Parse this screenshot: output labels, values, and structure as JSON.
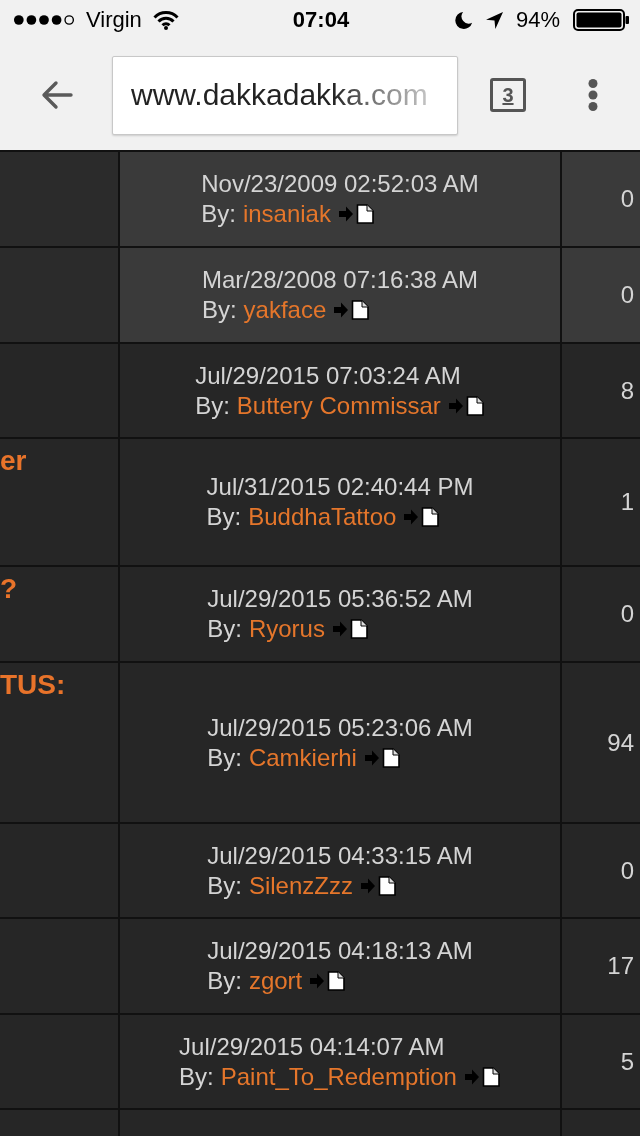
{
  "status_bar": {
    "carrier": "Virgin",
    "time": "07:04",
    "battery": "94%"
  },
  "toolbar": {
    "url": "www.dakkadakka.com",
    "tab_count": "3"
  },
  "table": {
    "rows": [
      {
        "highlighted": true,
        "date": "Nov/23/2009 02:52:03 AM",
        "by_label": "By:",
        "author": "insaniak",
        "replies": "0"
      },
      {
        "highlighted": true,
        "date": "Mar/28/2008 07:16:38 AM",
        "by_label": "By:",
        "author": "yakface",
        "replies": "0"
      },
      {
        "highlighted": false,
        "date": "Jul/29/2015 07:03:24 AM",
        "by_label": "By:",
        "author": "Buttery Commissar",
        "replies": "8"
      },
      {
        "highlighted": false,
        "title": "er",
        "date": "Jul/31/2015 02:40:44 PM",
        "by_label": "By:",
        "author": "BuddhaTattoo",
        "replies": "1"
      },
      {
        "highlighted": false,
        "title": "?",
        "date": "Jul/29/2015 05:36:52 AM",
        "by_label": "By:",
        "author": "Ryorus",
        "replies": "0"
      },
      {
        "highlighted": false,
        "title": "TUS:",
        "date": "Jul/29/2015 05:23:06 AM",
        "by_label": "By:",
        "author": "Camkierhi",
        "replies": "94"
      },
      {
        "highlighted": false,
        "date": "Jul/29/2015 04:33:15 AM",
        "by_label": "By:",
        "author": "SilenzZzz",
        "replies": "0"
      },
      {
        "highlighted": false,
        "date": "Jul/29/2015 04:18:13 AM",
        "by_label": "By:",
        "author": "zgort",
        "replies": "17"
      },
      {
        "highlighted": false,
        "date": "Jul/29/2015 04:14:07 AM",
        "by_label": "By:",
        "author": "Paint_To_Redemption",
        "replies": "5"
      },
      {
        "highlighted": false
      }
    ]
  }
}
